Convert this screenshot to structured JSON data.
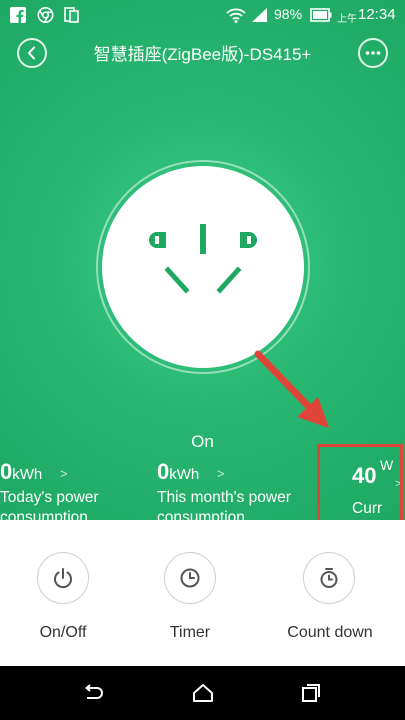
{
  "status_bar": {
    "battery_percent": "98%",
    "time_prefix": "上午",
    "time": "12:34",
    "left_icons": [
      "facebook-icon",
      "chrome-icon",
      "sim-card-icon"
    ],
    "right_icons": [
      "wifi-icon",
      "signal-icon",
      "battery-icon"
    ]
  },
  "header": {
    "title": "智慧插座(ZigBee版)-DS415+",
    "back_icon": "chevron-left-icon",
    "more_icon": "more-dots-icon"
  },
  "device": {
    "status": "On"
  },
  "stats": [
    {
      "value": "0",
      "unit": "kWh",
      "arrow": ">",
      "label_line1": "Today's power",
      "label_line2": "consumption"
    },
    {
      "value": "0",
      "unit": "kWh",
      "arrow": ">",
      "label_line1": "This month's power",
      "label_line2": "consumption"
    }
  ],
  "current": {
    "value": "40",
    "unit": "W",
    "label": "Curr",
    "arrow": ">"
  },
  "actions": [
    {
      "label": "On/Off",
      "icon": "power-icon"
    },
    {
      "label": "Timer",
      "icon": "clock-icon"
    },
    {
      "label": "Count down",
      "icon": "stopwatch-icon"
    }
  ],
  "colors": {
    "primary_green": "#27b772",
    "socket_green": "#1fa862",
    "highlight_red": "#e0453a"
  }
}
